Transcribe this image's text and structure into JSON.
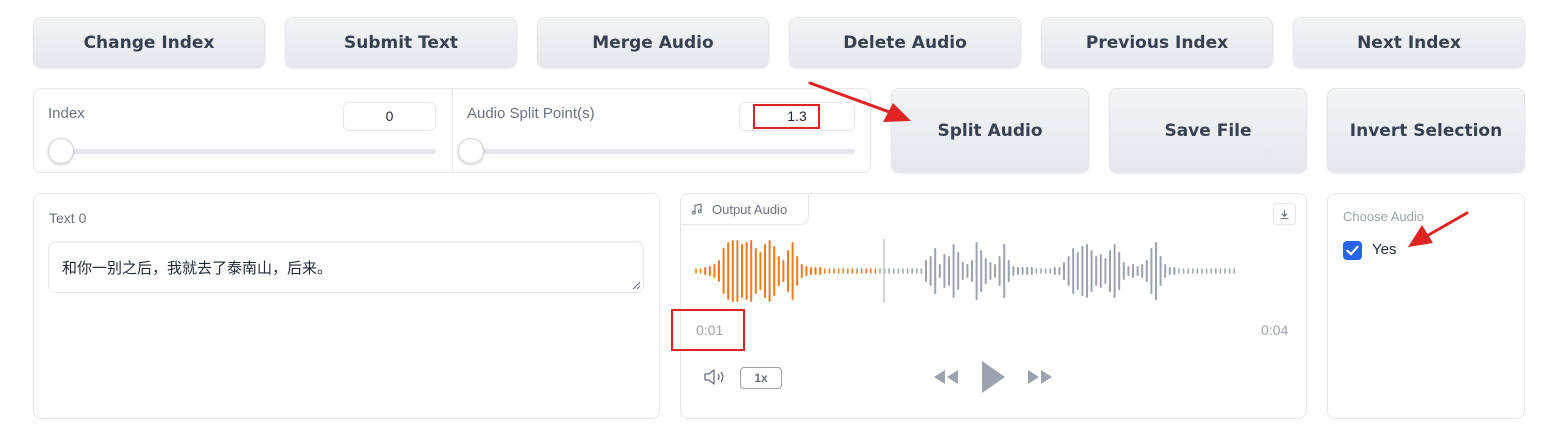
{
  "toolbar": {
    "change_index": "Change Index",
    "submit_text": "Submit Text",
    "merge_audio": "Merge Audio",
    "delete_audio": "Delete Audio",
    "previous_index": "Previous Index",
    "next_index": "Next Index"
  },
  "sliders": {
    "index": {
      "label": "Index",
      "value": "0",
      "fraction": 0.0
    },
    "split": {
      "label": "Audio Split Point(s)",
      "value": "1.3",
      "fraction": 0.01
    }
  },
  "actions": {
    "split_audio": "Split Audio",
    "save_file": "Save File",
    "invert_selection": "Invert Selection"
  },
  "text_panel": {
    "label": "Text 0",
    "value": "和你一别之后，我就去了泰南山，后来。"
  },
  "audio": {
    "label": "Output Audio",
    "current_time": "0:01",
    "duration": "0:04",
    "speed": "1x",
    "played_color": "#f07a1c",
    "unplayed_color": "#9ca3af"
  },
  "choose_audio": {
    "label": "Choose Audio",
    "option": "Yes",
    "checked": true
  },
  "colors": {
    "accent": "#2563eb",
    "annotation": "#e02424"
  }
}
